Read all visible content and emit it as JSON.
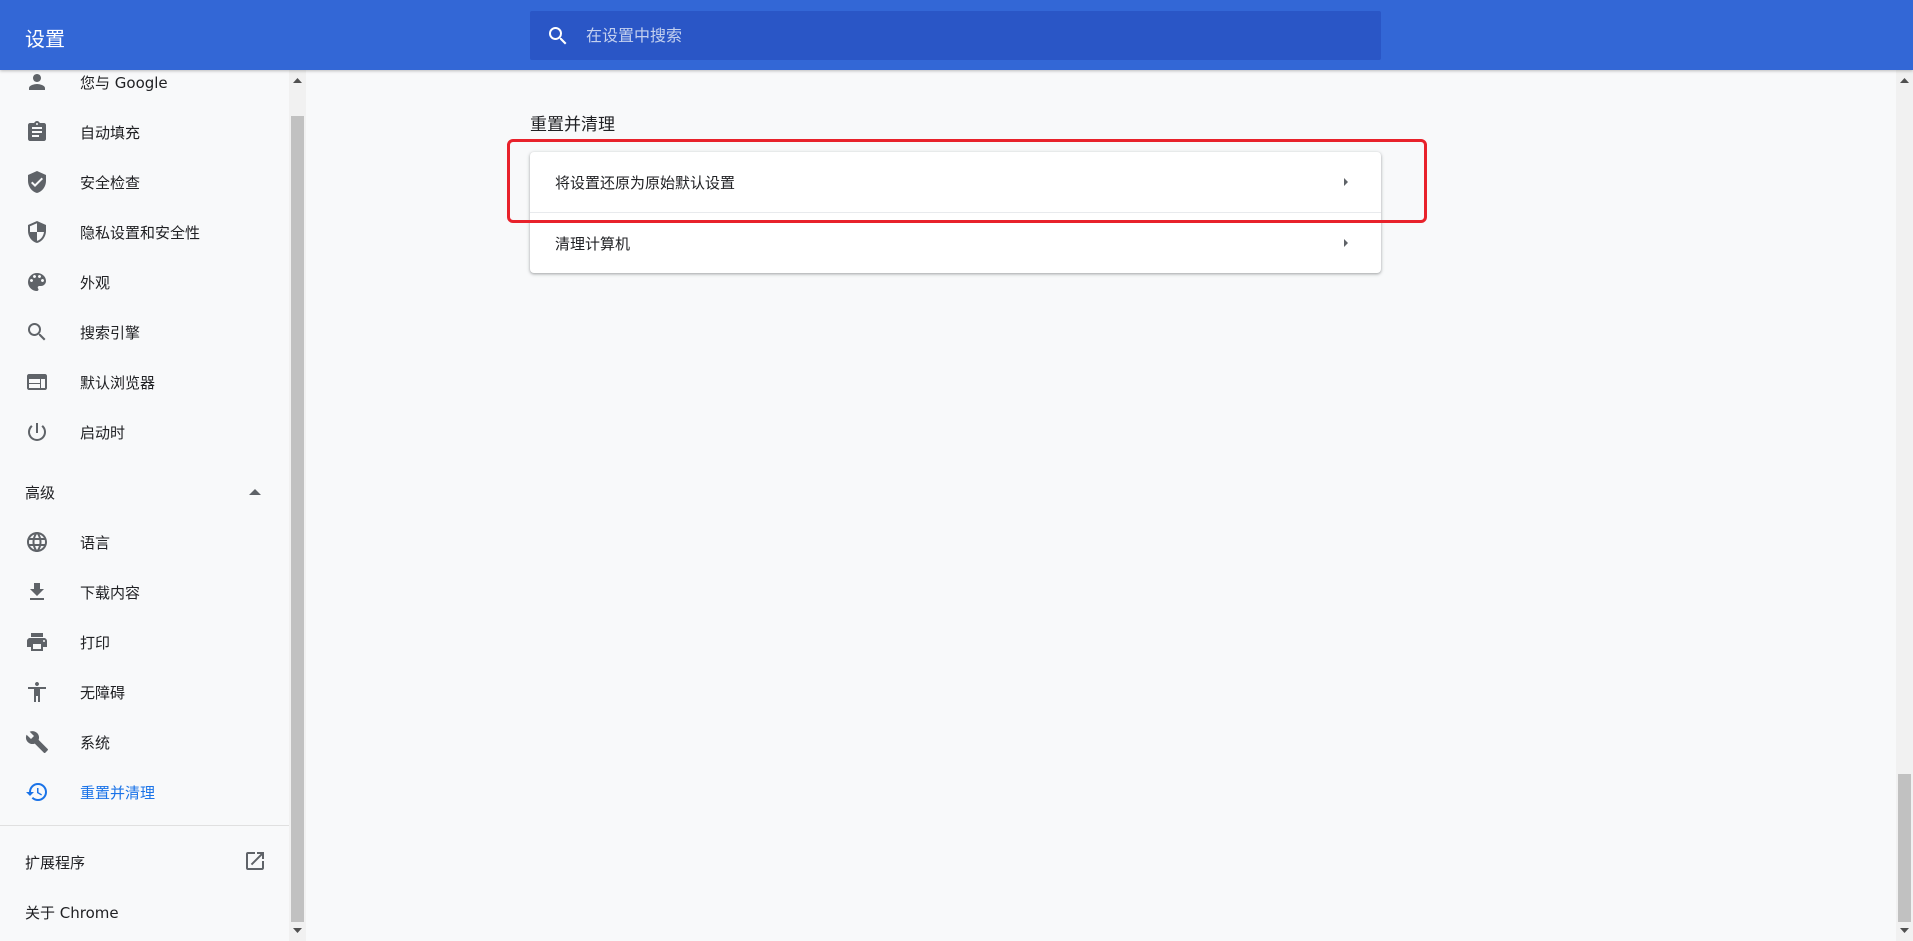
{
  "header": {
    "title": "设置",
    "search_placeholder": "在设置中搜索",
    "search_value": ""
  },
  "sidebar": {
    "items": [
      {
        "label": "您与 Google",
        "icon": "person-icon"
      },
      {
        "label": "自动填充",
        "icon": "clipboard-icon"
      },
      {
        "label": "安全检查",
        "icon": "shield-check-icon"
      },
      {
        "label": "隐私设置和安全性",
        "icon": "shield-half-icon"
      },
      {
        "label": "外观",
        "icon": "palette-icon"
      },
      {
        "label": "搜索引擎",
        "icon": "search-icon"
      },
      {
        "label": "默认浏览器",
        "icon": "browser-window-icon"
      },
      {
        "label": "启动时",
        "icon": "power-icon"
      }
    ],
    "advanced_label": "高级",
    "advanced_items": [
      {
        "label": "语言",
        "icon": "globe-icon"
      },
      {
        "label": "下载内容",
        "icon": "download-icon"
      },
      {
        "label": "打印",
        "icon": "printer-icon"
      },
      {
        "label": "无障碍",
        "icon": "accessibility-icon"
      },
      {
        "label": "系统",
        "icon": "wrench-icon"
      },
      {
        "label": "重置并清理",
        "icon": "history-icon",
        "active": true
      }
    ],
    "extensions_label": "扩展程序",
    "about_label": "关于 Chrome"
  },
  "main": {
    "section_title": "重置并清理",
    "rows": [
      {
        "label": "将设置还原为原始默认设置"
      },
      {
        "label": "清理计算机"
      }
    ]
  },
  "colors": {
    "header_bg": "#3367d6",
    "search_bg": "#2a56c6",
    "active_item": "#1a73e8",
    "highlight_border": "#e8222b"
  }
}
